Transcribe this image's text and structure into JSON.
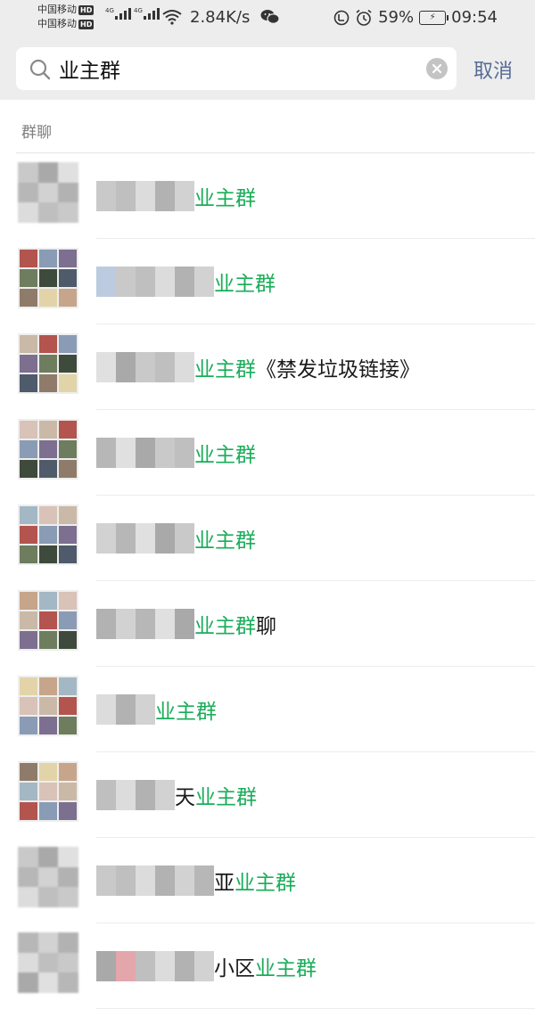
{
  "status_bar": {
    "carrier_1": "中国移动",
    "carrier_2": "中国移动",
    "hd_badge": "HD",
    "network_tag": "4G",
    "net_speed": "2.84K/s",
    "battery_percent": "59%",
    "time": "09:54"
  },
  "search": {
    "query": "业主群",
    "cancel_label": "取消"
  },
  "section": {
    "header": "群聊"
  },
  "results": [
    {
      "visible_suffix": "",
      "highlight": "业主群",
      "after": ""
    },
    {
      "visible_suffix": "",
      "highlight": "业主群",
      "after": ""
    },
    {
      "visible_suffix": "",
      "highlight": "业主群",
      "after": "《禁发垃圾链接》"
    },
    {
      "visible_suffix": "",
      "highlight": "业主群",
      "after": ""
    },
    {
      "visible_suffix": "",
      "highlight": "业主群",
      "after": ""
    },
    {
      "visible_suffix": "",
      "highlight": "业主群",
      "after": "聊"
    },
    {
      "visible_suffix": "",
      "highlight": "业主群",
      "after": ""
    },
    {
      "visible_suffix": "天",
      "highlight": "业主群",
      "after": ""
    },
    {
      "visible_suffix": "亚",
      "highlight": "业主群",
      "after": ""
    },
    {
      "visible_suffix": "小区",
      "highlight": "业主群",
      "after": ""
    }
  ],
  "colors": {
    "highlight": "#1aad5a",
    "cancel": "#576b95",
    "header_bg": "#ededed"
  }
}
